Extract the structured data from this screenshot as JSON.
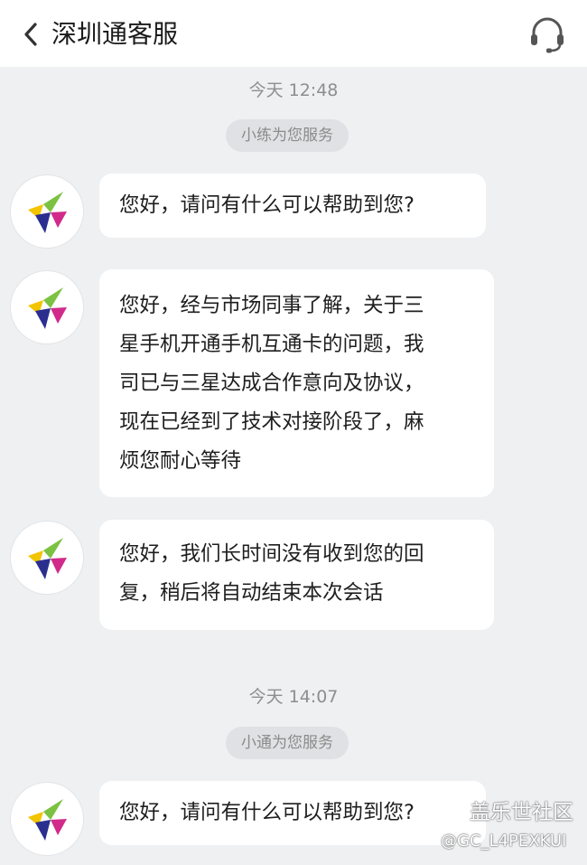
{
  "header": {
    "back_icon": "chevron-left-icon",
    "title": "深圳通客服",
    "service_icon": "headset-icon"
  },
  "sessions": [
    {
      "timestamp": "今天 12:48",
      "agent_notice": "小练为您服务",
      "messages": [
        {
          "lines": [
            "您好，请问有什么可以帮助到您?"
          ]
        },
        {
          "lines": [
            "您好，经与市场同事了解，关于三",
            "星手机开通手机互通卡的问题，我",
            "司已与三星达成合作意向及协议，",
            "现在已经到了技术对接阶段了，麻",
            "烦您耐心等待"
          ]
        },
        {
          "lines": [
            "您好，我们长时间没有收到您的回",
            "复，稍后将自动结束本次会话"
          ]
        }
      ]
    },
    {
      "timestamp": "今天 14:07",
      "agent_notice": "小通为您服务",
      "messages": [
        {
          "lines": [
            "您好，请问有什么可以帮助到您?"
          ]
        }
      ]
    }
  ],
  "avatar_icon": "shenzhentong-logo-icon",
  "watermark": {
    "line1": "盖乐世社区",
    "line2": "@GC_L4PEXKUI"
  },
  "colors": {
    "background": "#eef0f2",
    "bubble": "#ffffff",
    "pill": "#dfe1e4",
    "muted_text": "#8e8e8e",
    "logo_yellow": "#f2c500",
    "logo_green": "#7cc242",
    "logo_navy": "#2a2f8f",
    "logo_magenta": "#d12a8a"
  }
}
